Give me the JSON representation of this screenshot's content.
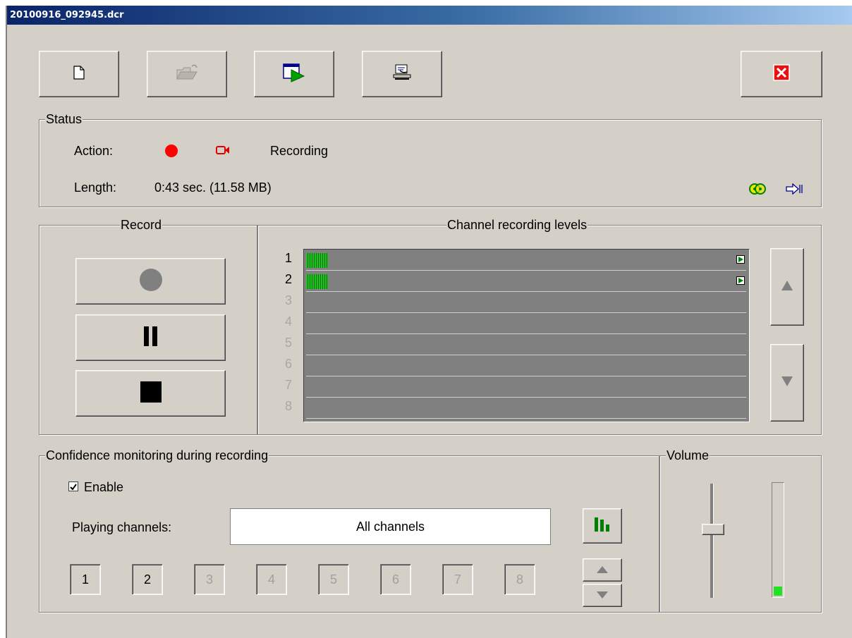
{
  "window": {
    "title": "20100916_092945.dcr"
  },
  "toolbar": {
    "buttons": [
      {
        "icon": "new-document-icon"
      },
      {
        "icon": "open-folder-icon"
      },
      {
        "icon": "play-window-icon"
      },
      {
        "icon": "publish-hand-icon"
      }
    ],
    "close_icon": "close-icon"
  },
  "status": {
    "title": "Status",
    "action_label": "Action:",
    "action_value": "Recording",
    "length_label": "Length:",
    "length_value": "0:43 sec. (11.58 MB)"
  },
  "record": {
    "title": "Record",
    "buttons": [
      "record-icon",
      "pause-icon",
      "stop-icon"
    ]
  },
  "levels": {
    "title": "Channel recording levels",
    "channels": [
      {
        "num": "1",
        "active": true,
        "level": 0.05
      },
      {
        "num": "2",
        "active": true,
        "level": 0.05
      },
      {
        "num": "3",
        "active": false
      },
      {
        "num": "4",
        "active": false
      },
      {
        "num": "5",
        "active": false
      },
      {
        "num": "6",
        "active": false
      },
      {
        "num": "7",
        "active": false
      },
      {
        "num": "8",
        "active": false
      }
    ]
  },
  "monitoring": {
    "title": "Confidence monitoring during recording",
    "enable_label": "Enable",
    "enable_checked": true,
    "playing_label": "Playing channels:",
    "playing_value": "All channels",
    "channel_buttons": [
      "1",
      "2",
      "3",
      "4",
      "5",
      "6",
      "7",
      "8"
    ]
  },
  "volume": {
    "title": "Volume",
    "slider_level": 0.4,
    "meter_level": 0.08
  },
  "colors": {
    "record_red": "#ff0000",
    "meter_green": "#22c022",
    "close_red": "#e81010"
  }
}
